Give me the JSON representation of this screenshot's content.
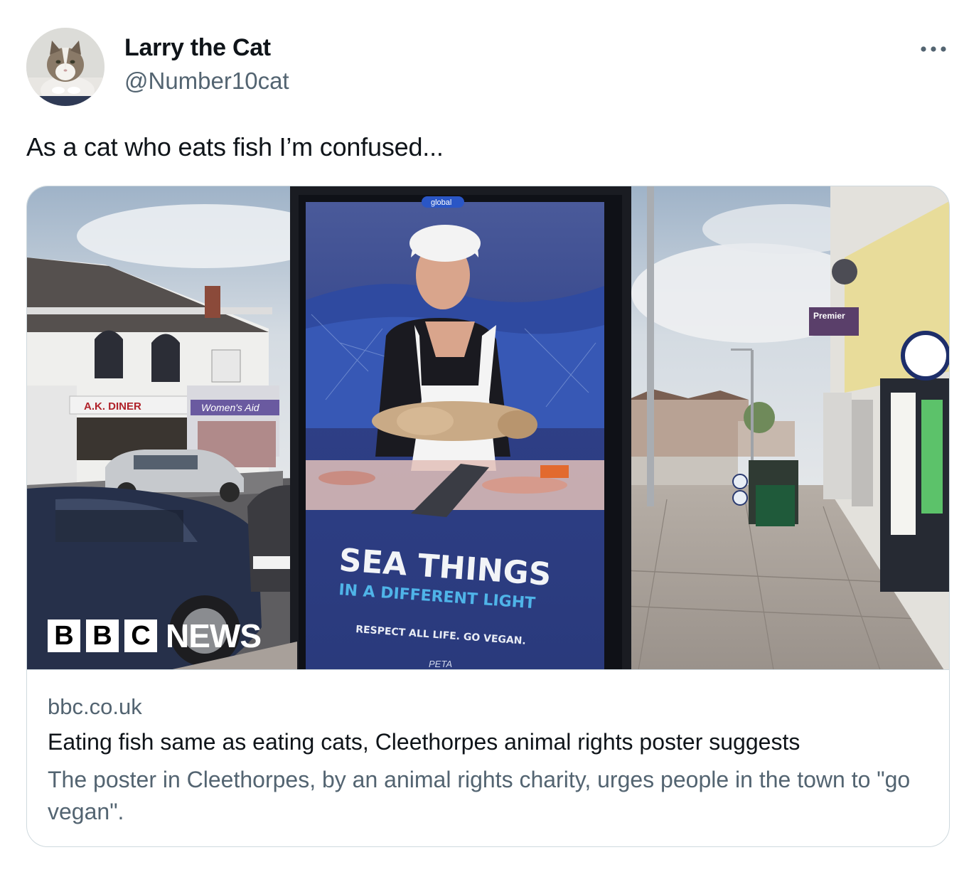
{
  "author": {
    "display_name": "Larry the Cat",
    "handle": "@Number10cat",
    "avatar_icon": "cat-avatar-photo"
  },
  "tweet": {
    "text": "As a cat who eats fish I’m confused..."
  },
  "menu": {
    "icon": "more-horizontal-icon"
  },
  "link_card": {
    "domain": "bbc.co.uk",
    "title": "Eating fish same as eating cats, Cleethorpes animal rights poster suggests",
    "description": "The poster in Cleethorpes, by an animal rights charity, urges people in the town to \"go vegan\".",
    "image": {
      "watermark": {
        "b1": "B",
        "b2": "B",
        "c": "C",
        "news": "NEWS"
      },
      "poster": {
        "brand": "global",
        "headline": "SEA THINGS",
        "subheadline": "IN A DIFFERENT LIGHT",
        "tagline": "RESPECT ALL LIFE. GO VEGAN.",
        "org": "PETA"
      },
      "shop_signs": {
        "diner": "A.K. DINER",
        "womens_aid": "Women's Aid",
        "premier": "Premier"
      }
    }
  },
  "colors": {
    "text_primary": "#0f1419",
    "text_secondary": "#536471",
    "border": "#cfd9de"
  }
}
